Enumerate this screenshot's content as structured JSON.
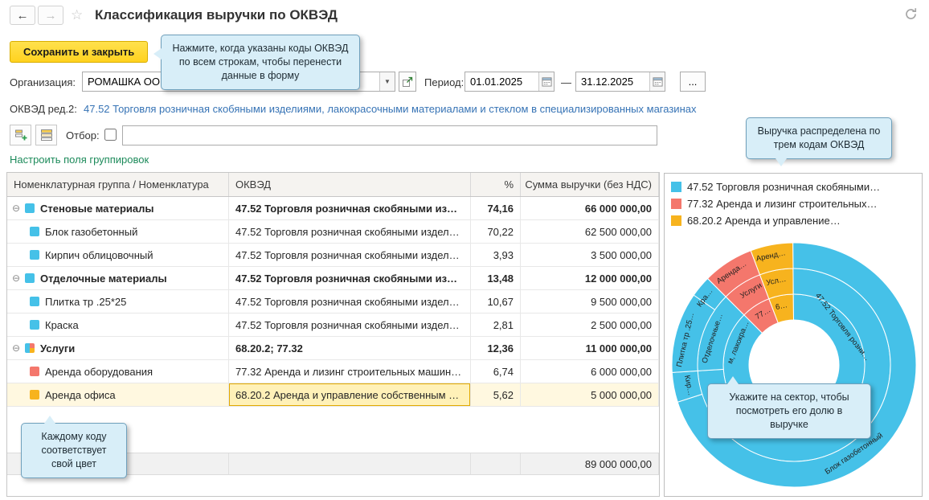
{
  "window": {
    "title": "Классификация выручки по ОКВЭД"
  },
  "icons": {
    "back": "←",
    "forward": "→",
    "star": "☆",
    "dropdown": "▼",
    "expander": "⊖"
  },
  "buttons": {
    "save": "Сохранить и закрыть",
    "more": "..."
  },
  "form": {
    "organization_label": "Организация:",
    "organization_value": "РОМАШКА ОО",
    "period_label": "Период:",
    "period_from": "01.01.2025",
    "period_dash": "—",
    "period_to": "31.12.2025",
    "okved_label": "ОКВЭД ред.2:",
    "okved_value": "47.52 Торговля розничная скобяными изделиями, лакокрасочными материалами и стеклом в специализированных магазинах",
    "filter_label": "Отбор:",
    "configure_fields_link": "Настроить поля группировок"
  },
  "callouts": {
    "save_hint": "Нажмите, когда указаны коды ОКВЭД по всем строкам, чтобы перенести данные в форму",
    "legend_hint": "Выручка распределена по трем кодам ОКВЭД",
    "color_hint": "Каждому коду соответствует свой цвет",
    "chart_hint": "Укажите на сектор, чтобы посмотреть его долю в выручке"
  },
  "table": {
    "columns": [
      "Номенклатурная группа / Номенклатура",
      "ОКВЭД",
      "%",
      "Сумма выручки (без НДС)"
    ],
    "rows": [
      {
        "kind": "group",
        "color": "#45C1E8",
        "name": "Стеновые материалы",
        "okved": "47.52 Торговля розничная скобяными из…",
        "pct": "74,16",
        "sum": "66 000 000,00"
      },
      {
        "kind": "item",
        "color": "#45C1E8",
        "name": "Блок газобетонный",
        "okved": "47.52 Торговля розничная скобяными издел…",
        "pct": "70,22",
        "sum": "62 500 000,00"
      },
      {
        "kind": "item",
        "color": "#45C1E8",
        "name": "Кирпич облицовочный",
        "okved": "47.52 Торговля розничная скобяными издел…",
        "pct": "3,93",
        "sum": "3 500 000,00"
      },
      {
        "kind": "group",
        "color": "#45C1E8",
        "name": "Отделочные материалы",
        "okved": "47.52 Торговля розничная скобяными из…",
        "pct": "13,48",
        "sum": "12 000 000,00"
      },
      {
        "kind": "item",
        "color": "#45C1E8",
        "name": "Плитка тр .25*25",
        "okved": "47.52 Торговля розничная скобяными издел…",
        "pct": "10,67",
        "sum": "9 500 000,00"
      },
      {
        "kind": "item",
        "color": "#45C1E8",
        "name": "Краска",
        "okved": "47.52 Торговля розничная скобяными издел…",
        "pct": "2,81",
        "sum": "2 500 000,00"
      },
      {
        "kind": "group",
        "color": "multi",
        "name": "Услуги",
        "okved": "68.20.2; 77.32",
        "pct": "12,36",
        "sum": "11 000 000,00"
      },
      {
        "kind": "item",
        "color": "#F4776C",
        "name": "Аренда оборудования",
        "okved": "77.32 Аренда и лизинг строительных машин…",
        "pct": "6,74",
        "sum": "6 000 000,00"
      },
      {
        "kind": "item",
        "color": "#F7B31E",
        "name": "Аренда офиса",
        "okved": "68.20.2 Аренда и управление собственным …",
        "pct": "5,62",
        "sum": "5 000 000,00",
        "selected": true
      }
    ],
    "total": "89 000 000,00"
  },
  "legend": {
    "items": [
      {
        "color": "#45C1E8",
        "label": "47.52 Торговля розничная скобяными…"
      },
      {
        "color": "#F4776C",
        "label": "77.32 Аренда и лизинг строительных…"
      },
      {
        "color": "#F7B31E",
        "label": "68.20.2 Аренда и управление…"
      }
    ]
  },
  "palette": {
    "blue": "#45C1E8",
    "red": "#F4776C",
    "yellow": "#F7B31E",
    "selection_cell": "#FFF1B8",
    "selection_row": "#FFF8E0",
    "save_button": "#FFD21F"
  },
  "chart_data": {
    "type": "sunburst",
    "start_angle": 315,
    "center": [
      161,
      168
    ],
    "rings": [
      {
        "name": "okved_codes",
        "r0": 56,
        "r1": 88,
        "segments": [
          {
            "label": "77.32",
            "value": 6.74,
            "color": "#F4776C"
          },
          {
            "label": "68.20.2",
            "value": 5.62,
            "color": "#F7B31E"
          },
          {
            "label": "47.52",
            "value": 87.64,
            "color": "#45C1E8"
          }
        ]
      },
      {
        "name": "groups",
        "r0": 88,
        "r1": 120,
        "segments": [
          {
            "label": "Услуги (77.32)",
            "value": 6.74,
            "color": "#F4776C"
          },
          {
            "label": "Услуги (68.20.2)",
            "value": 5.62,
            "color": "#F7B31E"
          },
          {
            "label": "Стеновые материалы",
            "value": 74.16,
            "color": "#45C1E8"
          },
          {
            "label": "Отделочные материалы",
            "value": 13.48,
            "color": "#45C1E8"
          }
        ]
      },
      {
        "name": "items",
        "r0": 120,
        "r1": 152,
        "segments": [
          {
            "label": "Аренда оборудования",
            "value": 6.74,
            "color": "#F4776C"
          },
          {
            "label": "Аренда офиса",
            "value": 5.62,
            "color": "#F7B31E"
          },
          {
            "label": "Блок газобетонный",
            "value": 70.22,
            "color": "#45C1E8"
          },
          {
            "label": "Кирпич облицовочный",
            "value": 3.93,
            "color": "#45C1E8"
          },
          {
            "label": "Плитка тр .25*25",
            "value": 10.67,
            "color": "#45C1E8"
          },
          {
            "label": "Краска",
            "value": 2.81,
            "color": "#45C1E8"
          }
        ]
      }
    ],
    "labels": [
      {
        "text": "Аренда…",
        "a": 326,
        "r": 136,
        "rot": -34
      },
      {
        "text": "Аренд…",
        "a": 348,
        "r": 136,
        "rot": -12
      },
      {
        "text": "Услуги",
        "a": 330,
        "r": 104,
        "rot": -30
      },
      {
        "text": "Усл…",
        "a": 348,
        "r": 104,
        "rot": -12
      },
      {
        "text": "77…",
        "a": 329,
        "r": 72,
        "rot": -31
      },
      {
        "text": "6…",
        "a": 348,
        "r": 72,
        "rot": -12
      },
      {
        "text": "47.52 Торговля розни…",
        "a": 52,
        "r": 74,
        "rot": 52
      },
      {
        "text": "м, лакокра…",
        "a": 292,
        "r": 72,
        "rot": -68
      },
      {
        "text": "Стеновые",
        "a": 138,
        "r": 104,
        "rot": -42
      },
      {
        "text": "Блок газобетонный",
        "a": 146,
        "r": 136,
        "rot": -34
      },
      {
        "text": "Кир…",
        "a": 259,
        "r": 136,
        "rot": 79
      },
      {
        "text": "Плитка тр .25…",
        "a": 283,
        "r": 136,
        "rot": -77
      },
      {
        "text": "Кра…",
        "a": 307,
        "r": 136,
        "rot": -53
      },
      {
        "text": "Отделочные…",
        "a": 288,
        "r": 104,
        "rot": -72
      }
    ]
  }
}
